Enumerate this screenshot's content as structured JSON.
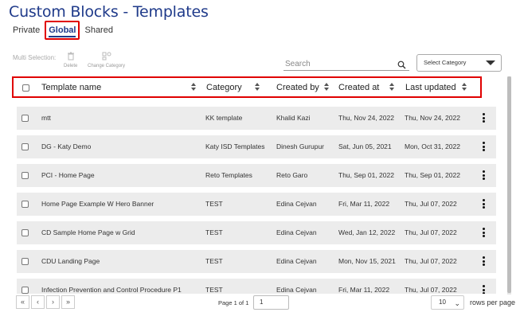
{
  "page": {
    "title": "Custom Blocks - Templates"
  },
  "tabs": [
    {
      "label": "Private"
    },
    {
      "label": "Global"
    },
    {
      "label": "Shared"
    }
  ],
  "toolbar": {
    "multi_selection_label": "Multi Selection:",
    "delete_label": "Delete",
    "change_category_label": "Change Category",
    "search_placeholder": "Search",
    "category_select": "Select Category"
  },
  "table": {
    "columns": [
      "Template name",
      "Category",
      "Created by",
      "Created at",
      "Last updated"
    ],
    "rows": [
      {
        "name": "mtt",
        "category": "KK template",
        "created_by": "Khalid Kazi",
        "created_at": "Thu, Nov 24, 2022",
        "last_updated": "Thu, Nov 24, 2022"
      },
      {
        "name": "DG - Katy Demo",
        "category": "Katy ISD Templates",
        "created_by": "Dinesh Gurupur",
        "created_at": "Sat, Jun 05, 2021",
        "last_updated": "Mon, Oct 31, 2022"
      },
      {
        "name": "PCI - Home Page",
        "category": "Reto Templates",
        "created_by": "Reto Garo",
        "created_at": "Thu, Sep 01, 2022",
        "last_updated": "Thu, Sep 01, 2022"
      },
      {
        "name": "Home Page Example W Hero Banner",
        "category": "TEST",
        "created_by": "Edina Cejvan",
        "created_at": "Fri, Mar 11, 2022",
        "last_updated": "Thu, Jul 07, 2022"
      },
      {
        "name": "CD Sample Home Page w Grid",
        "category": "TEST",
        "created_by": "Edina Cejvan",
        "created_at": "Wed, Jan 12, 2022",
        "last_updated": "Thu, Jul 07, 2022"
      },
      {
        "name": "CDU Landing Page",
        "category": "TEST",
        "created_by": "Edina Cejvan",
        "created_at": "Mon, Nov 15, 2021",
        "last_updated": "Thu, Jul 07, 2022"
      },
      {
        "name": "Infection Prevention and Control Procedure P1",
        "category": "TEST",
        "created_by": "Edina Cejvan",
        "created_at": "Fri, Mar 11, 2022",
        "last_updated": "Thu, Jul 07, 2022"
      }
    ]
  },
  "pagination": {
    "first": "«",
    "prev": "‹",
    "next": "›",
    "last": "»",
    "page_info": "Page 1 of 1",
    "page_value": "1",
    "per_page_value": "10",
    "per_page_label": "rows per page"
  }
}
